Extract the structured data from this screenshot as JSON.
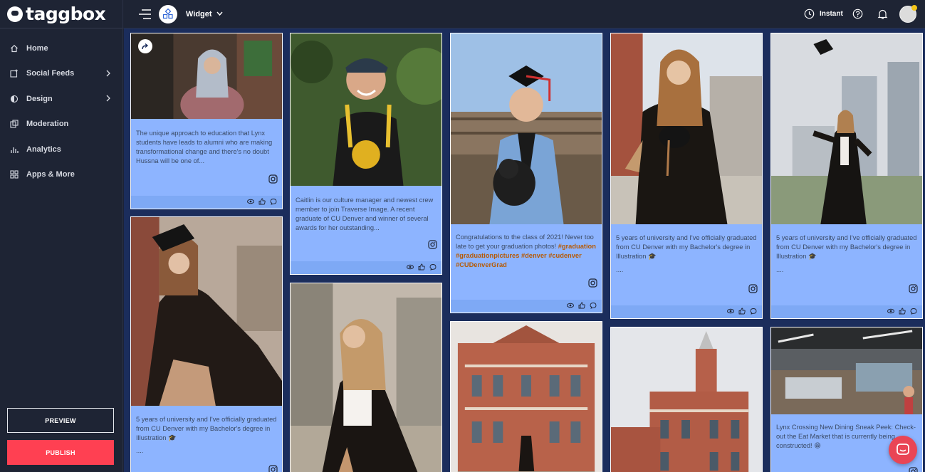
{
  "brand": {
    "name": "taggbox"
  },
  "sidebar": {
    "items": [
      {
        "label": "Home",
        "icon": "home-icon",
        "has_submenu": false
      },
      {
        "label": "Social Feeds",
        "icon": "social-feeds-icon",
        "has_submenu": true
      },
      {
        "label": "Design",
        "icon": "design-icon",
        "has_submenu": true
      },
      {
        "label": "Moderation",
        "icon": "moderation-icon",
        "has_submenu": false
      },
      {
        "label": "Analytics",
        "icon": "analytics-icon",
        "has_submenu": false
      },
      {
        "label": "Apps & More",
        "icon": "apps-icon",
        "has_submenu": false
      }
    ],
    "preview_label": "PREVIEW",
    "publish_label": "PUBLISH"
  },
  "topbar": {
    "widget_label": "Widget",
    "instant_label": "Instant"
  },
  "colors": {
    "card_bg": "#8db4ff",
    "feed_bg": "#1b2d5c",
    "publish": "#ff4052",
    "hashtag": "#b65a05"
  },
  "cards": [
    {
      "id": "c1",
      "text": "The unique approach to education that Lynx students have leads to alumni who are making transformational change and there's no doubt Hussna will be one of...",
      "image": "woman in headscarf at outdoor cafe"
    },
    {
      "id": "c2",
      "text": "5 years of university and I've officially graduated from CU Denver with my Bachelor's degree in Illustration 🎓",
      "extra": "....",
      "image": "graduate in cap and gown sitting"
    },
    {
      "id": "c3",
      "text": "Caitlin is our culture manager and newest crew member to join Traverse Image. A recent graduate of CU Denver and winner of several awards for her outstanding...",
      "image": "smiling woman with cap"
    },
    {
      "id": "c4",
      "image": "graduate in gown looking away"
    },
    {
      "id": "c5",
      "text": "Congratulations to the class of 2021! Never too late to get your graduation photos!",
      "hashtags": "#graduation #graduationpictures #denver #cudenver #CUDenverGrad",
      "image": "graduate with dog"
    },
    {
      "id": "c6",
      "image": "historic red brick building"
    },
    {
      "id": "c7",
      "text": "5 years of university and I've officially graduated from CU Denver with my Bachelor's degree in Illustration 🎓",
      "extra": "....",
      "image": "graduate leaning against brick wall"
    },
    {
      "id": "c8",
      "image": "red brick clock tower building"
    },
    {
      "id": "c9",
      "text": "5 years of university and I've officially graduated from CU Denver with my Bachelor's degree in Illustration 🎓",
      "extra": "....",
      "image": "graduate tossing cap downtown"
    },
    {
      "id": "c10",
      "text": "Lynx Crossing New Dining Sneak Peek: Check-out the Eat Market that is currently being constructed! 😁",
      "image": "dining hall interior"
    }
  ]
}
